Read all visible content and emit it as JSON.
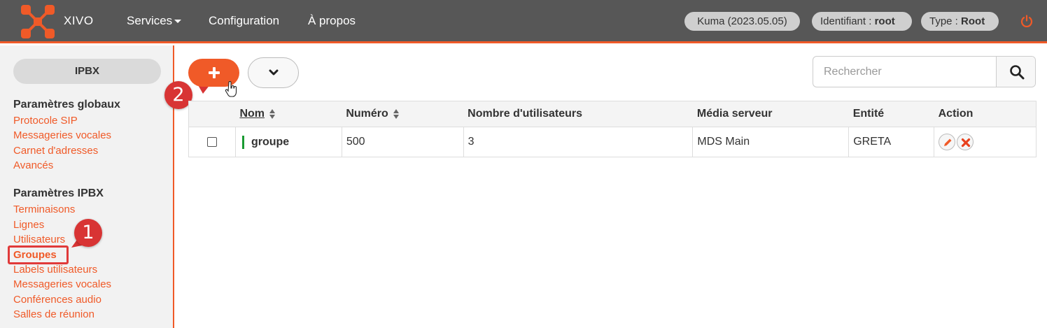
{
  "colors": {
    "accent": "#f05a28",
    "navbar": "#575757",
    "annotation": "#d83434",
    "status_green": "#1a9a32"
  },
  "navbar": {
    "brand": "XIVO",
    "items": [
      {
        "label": "Services",
        "has_dropdown": true
      },
      {
        "label": "Configuration"
      },
      {
        "label": "À propos"
      }
    ],
    "version": "Kuma (2023.05.05)",
    "identifiant_label": "Identifiant : ",
    "identifiant_value": "root",
    "type_label": "Type : ",
    "type_value": "Root",
    "logout_icon": "power-icon"
  },
  "sidebar": {
    "section_button": "IPBX",
    "group1_title": "Paramètres globaux",
    "group1_items": [
      "Protocole SIP",
      "Messageries vocales",
      "Carnet d'adresses",
      "Avancés"
    ],
    "group2_title": "Paramètres IPBX",
    "group2_items": [
      "Terminaisons",
      "Lignes",
      "Utilisateurs",
      "Groupes",
      "Labels utilisateurs",
      "Messageries vocales",
      "Conférences audio",
      "Salles de réunion"
    ],
    "active_item": "Groupes"
  },
  "annotations": {
    "step1": "1",
    "step2": "2"
  },
  "toolbar": {
    "add_icon": "plus-icon",
    "dropdown_icon": "chevron-down-icon"
  },
  "search": {
    "placeholder": "Rechercher",
    "value": ""
  },
  "table": {
    "columns": [
      "",
      "Nom",
      "Numéro",
      "Nombre d'utilisateurs",
      "Média serveur",
      "Entité",
      "Action"
    ],
    "rows": [
      {
        "checked": false,
        "nom": "groupe",
        "numero": "500",
        "nb_utilisateurs": "3",
        "media_serveur": "MDS Main",
        "entite": "GRETA"
      }
    ]
  }
}
